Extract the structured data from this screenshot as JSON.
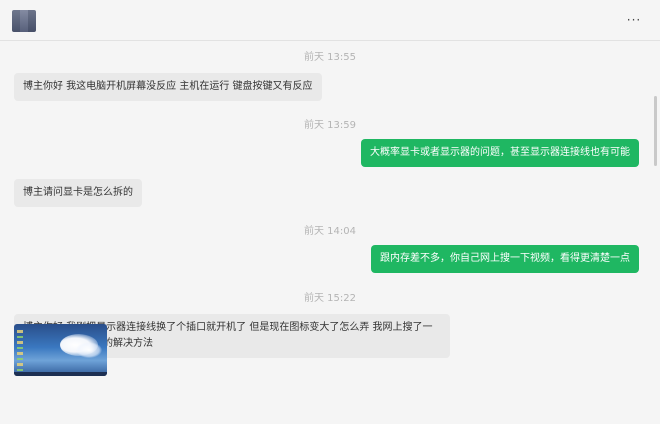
{
  "header": {
    "menu_icon": "more-dots-icon",
    "menu_glyph": "···"
  },
  "messages": [
    {
      "kind": "time",
      "text": "前天 13:55"
    },
    {
      "kind": "left",
      "text": "博主你好 我这电脑开机屏幕没反应 主机在运行 键盘按键又有反应"
    },
    {
      "kind": "time",
      "text": "前天 13:59"
    },
    {
      "kind": "right",
      "text": "大概率显卡或者显示器的问题，甚至显示器连接线也有可能"
    },
    {
      "kind": "left",
      "text": "博主请问显卡是怎么拆的"
    },
    {
      "kind": "time",
      "text": "前天 14:04"
    },
    {
      "kind": "right",
      "text": "跟内存差不多，你自己网上搜一下视频，看得更清楚一点"
    },
    {
      "kind": "time",
      "text": "前天 15:22"
    },
    {
      "kind": "left",
      "text": "博主你好 我刚把显示器连接线换了个插口就开机了 但是现在图标变大了怎么弄 我网上搜了一下没看到这种情况的解决方法"
    },
    {
      "kind": "image",
      "alt": "desktop-screenshot"
    }
  ],
  "colors": {
    "background": "#f5f5f5",
    "left_bubble": "#e9e9e9",
    "right_bubble": "#1fb762",
    "timestamp": "#b4b4b4"
  }
}
